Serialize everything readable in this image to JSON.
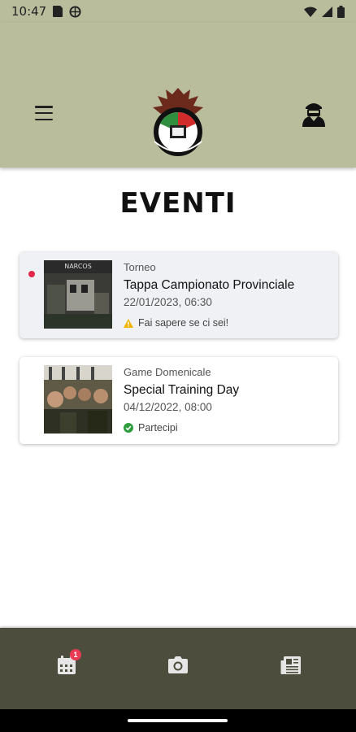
{
  "status_bar": {
    "time": "10:47"
  },
  "header": {
    "title": "EVENTI"
  },
  "events": [
    {
      "category": "Torneo",
      "title": "Tappa Campionato Provinciale",
      "datetime": "22/01/2023, 06:30",
      "status": "Fai sapere se ci sei!",
      "status_icon": "warning-icon",
      "unread": true,
      "thumb_text": "NARCOS"
    },
    {
      "category": "Game Domenicale",
      "title": "Special Training Day",
      "datetime": "04/12/2022, 08:00",
      "status": "Partecipi",
      "status_icon": "check-circle-icon",
      "unread": false
    }
  ],
  "bottom_nav": {
    "calendar_badge": "1"
  },
  "colors": {
    "header_bg": "#b9bd9c",
    "nav_bg": "#4c4d3c",
    "badge": "#ea3b52",
    "warning": "#f0b400",
    "success": "#2e9e3e"
  }
}
